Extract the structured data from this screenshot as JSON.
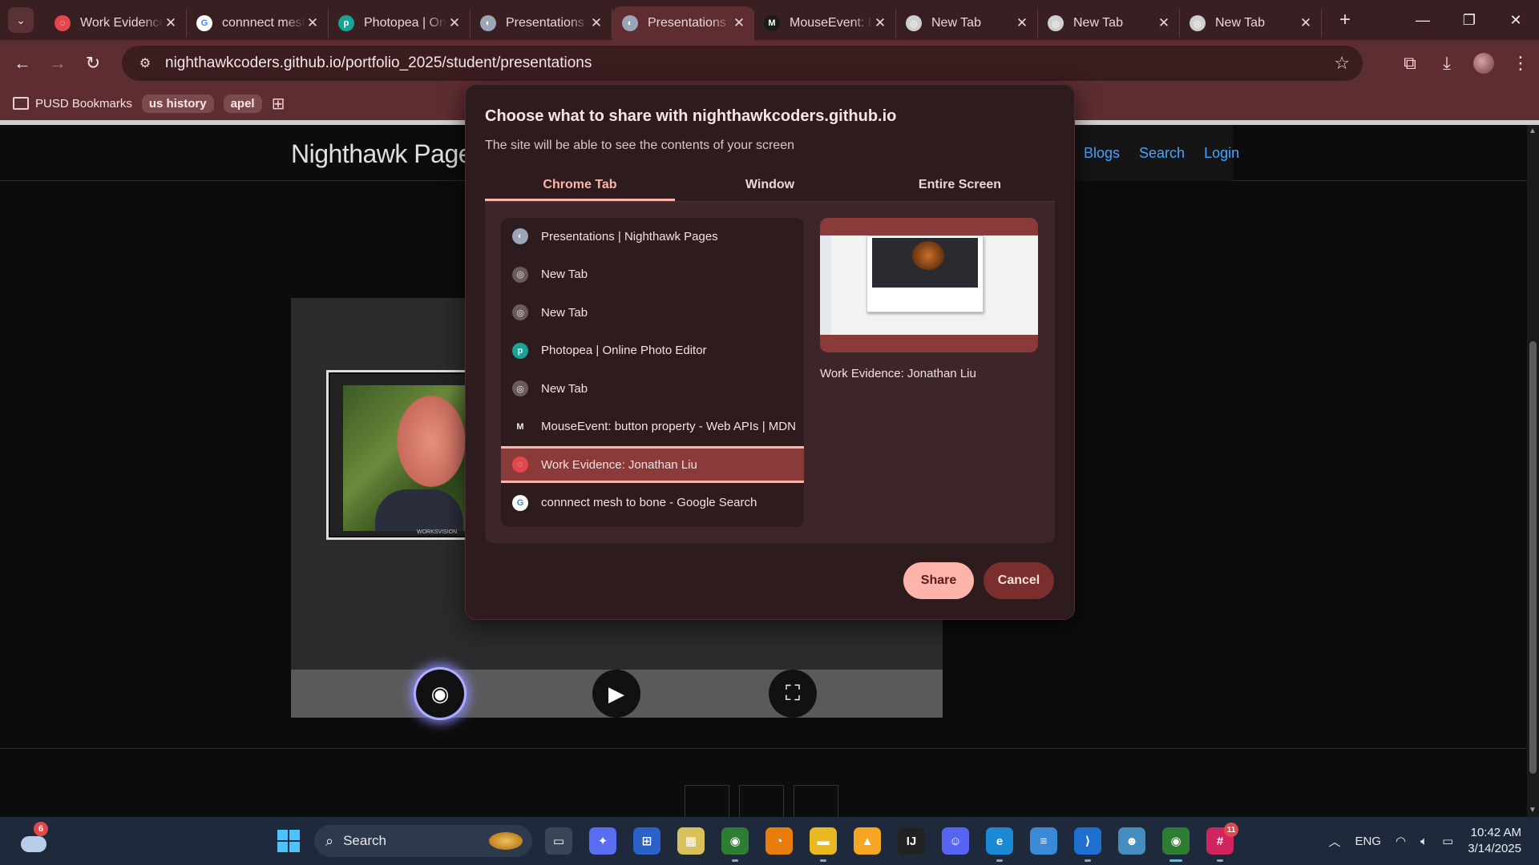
{
  "browser": {
    "tabs": [
      {
        "title": "Work Evidence: Jonathan Liu",
        "favicon": "red-ring-icon",
        "color": "#e2474c",
        "active": false
      },
      {
        "title": "connnect mesh to bone - Google Search",
        "favicon": "google-icon",
        "color": "#ffffff",
        "active": false
      },
      {
        "title": "Photopea | Online Photo Editor",
        "favicon": "photopea-icon",
        "color": "#18a497",
        "active": false
      },
      {
        "title": "Presentations | Nighthawk Pages",
        "favicon": "globe-icon",
        "color": "#9aa6b5",
        "active": false
      },
      {
        "title": "Presentations | Nighthawk Pages",
        "favicon": "globe-icon",
        "color": "#9aa6b5",
        "active": true
      },
      {
        "title": "MouseEvent: button property",
        "favicon": "mdn-icon",
        "color": "#1b1b1b",
        "active": false
      },
      {
        "title": "New Tab",
        "favicon": "chrome-icon",
        "color": "#cfcfcf",
        "active": false
      },
      {
        "title": "New Tab",
        "favicon": "chrome-icon",
        "color": "#cfcfcf",
        "active": false
      },
      {
        "title": "New Tab",
        "favicon": "chrome-icon",
        "color": "#cfcfcf",
        "active": false
      }
    ],
    "url": "nighthawkcoders.github.io/portfolio_2025/student/presentations",
    "bookmarks": [
      {
        "label": "PUSD Bookmarks",
        "type": "folder"
      },
      {
        "label": "us history",
        "type": "chip"
      },
      {
        "label": "apel",
        "type": "chip"
      }
    ]
  },
  "site": {
    "brand": "Nighthawk Pages",
    "nav": [
      "Blogs",
      "Search",
      "Login"
    ],
    "slide_caption": "WORKSVISION"
  },
  "dialog": {
    "title": "Choose what to share with nighthawkcoders.github.io",
    "subtitle": "The site will be able to see the contents of your screen",
    "tabs": [
      "Chrome Tab",
      "Window",
      "Entire Screen"
    ],
    "active_tab": "Chrome Tab",
    "list": [
      {
        "label": "Presentations | Nighthawk Pages",
        "favicon": "globe-icon",
        "color": "#9aa6b5",
        "selected": false
      },
      {
        "label": "New Tab",
        "favicon": "chrome-icon",
        "color": "#6b5a5c",
        "selected": false
      },
      {
        "label": "New Tab",
        "favicon": "chrome-icon",
        "color": "#6b5a5c",
        "selected": false
      },
      {
        "label": "Photopea | Online Photo Editor",
        "favicon": "photopea-icon",
        "color": "#18a497",
        "selected": false
      },
      {
        "label": "New Tab",
        "favicon": "chrome-icon",
        "color": "#6b5a5c",
        "selected": false
      },
      {
        "label": "MouseEvent: button property - Web APIs | MDN",
        "favicon": "mdn-icon",
        "color": "#2d1b1d",
        "selected": false
      },
      {
        "label": "Work Evidence: Jonathan Liu",
        "favicon": "red-ring-icon",
        "color": "#e2474c",
        "selected": true
      },
      {
        "label": "connnect mesh to bone - Google Search",
        "favicon": "google-icon",
        "color": "#ffffff",
        "selected": false
      }
    ],
    "preview_caption": "Work Evidence: Jonathan Liu",
    "share_label": "Share",
    "cancel_label": "Cancel",
    "accent": "#ffb4ab"
  },
  "taskbar": {
    "weather_badge": "6",
    "search_placeholder": "Search",
    "apps": [
      {
        "name": "task-view-icon",
        "color": "#3a4658",
        "glyph": "▭"
      },
      {
        "name": "copilot-icon",
        "color": "#5a6cf0",
        "glyph": "✦"
      },
      {
        "name": "store-icon",
        "color": "#2a62c8",
        "glyph": "⊞"
      },
      {
        "name": "calendar-app-icon",
        "color": "#d8c05a",
        "glyph": "▦"
      },
      {
        "name": "chrome-icon",
        "color": "#2e7d32",
        "glyph": "◉"
      },
      {
        "name": "blender-icon",
        "color": "#e87d0d",
        "glyph": "◔"
      },
      {
        "name": "file-explorer-icon",
        "color": "#e8b923",
        "glyph": "▬"
      },
      {
        "name": "firebase-icon",
        "color": "#f5a623",
        "glyph": "▲"
      },
      {
        "name": "intellij-icon",
        "color": "#222222",
        "glyph": "IJ"
      },
      {
        "name": "discord-icon",
        "color": "#5865f2",
        "glyph": "☺"
      },
      {
        "name": "edge-icon",
        "color": "#1a8ad4",
        "glyph": "e"
      },
      {
        "name": "notepad-icon",
        "color": "#3b8ad8",
        "glyph": "≡"
      },
      {
        "name": "vscode-icon",
        "color": "#1f6fd0",
        "glyph": "⟩"
      },
      {
        "name": "godot-icon",
        "color": "#478cbf",
        "glyph": "☻"
      },
      {
        "name": "chrome-profile-icon",
        "color": "#2e7d32",
        "glyph": "◉"
      },
      {
        "name": "slack-icon",
        "color": "#d0245e",
        "glyph": "#"
      }
    ],
    "slack_badge": "11",
    "language": "ENG",
    "time": "10:42 AM",
    "date": "3/14/2025"
  }
}
